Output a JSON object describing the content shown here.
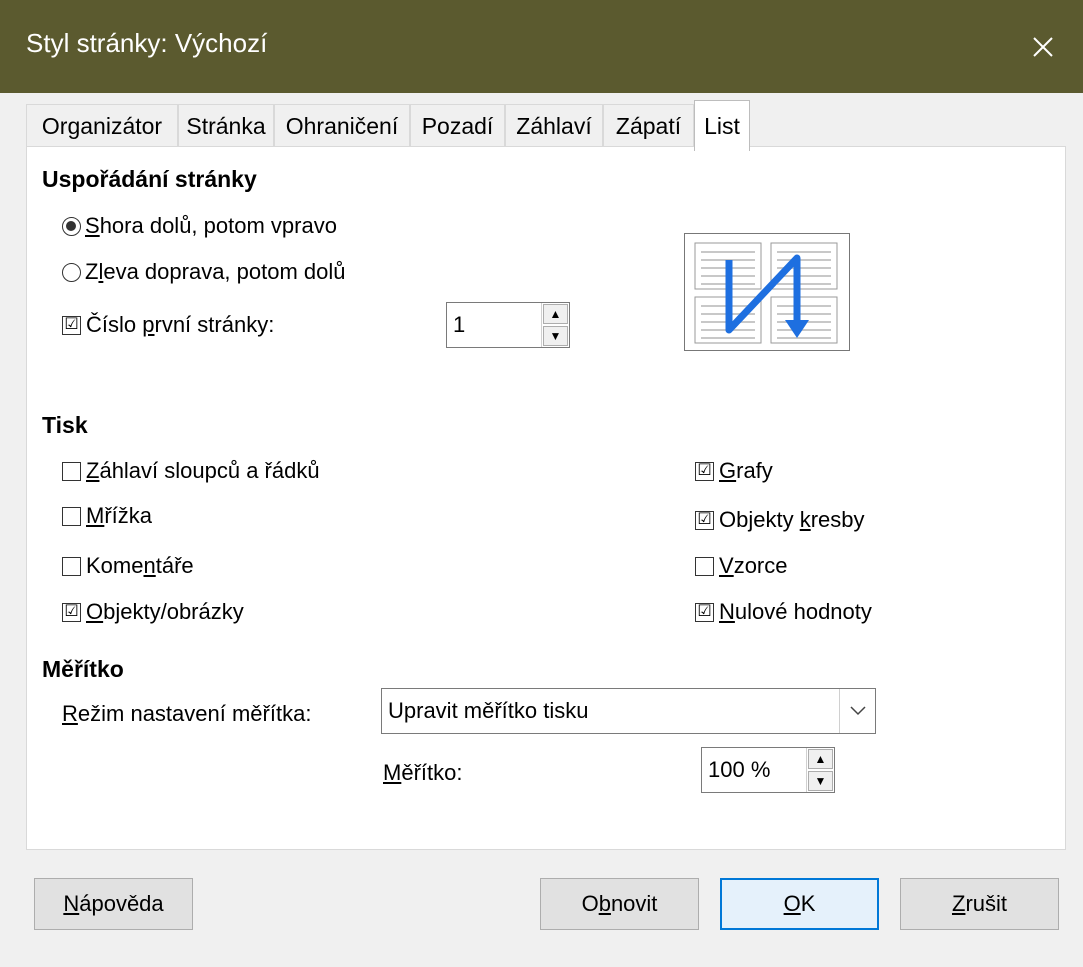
{
  "window": {
    "title": "Styl stránky: Výchozí",
    "close_icon": "close-icon"
  },
  "tabs": [
    {
      "label": "Organizátor"
    },
    {
      "label": "Stránka"
    },
    {
      "label": "Ohraničení"
    },
    {
      "label": "Pozadí"
    },
    {
      "label": "Záhlaví"
    },
    {
      "label": "Zápatí"
    },
    {
      "label": "List",
      "active": true
    }
  ],
  "page_order": {
    "heading": "Uspořádání stránky",
    "top_bottom": {
      "pre": "",
      "u": "S",
      "post": "hora dolů, potom vpravo",
      "selected": true
    },
    "left_right": {
      "pre": "Z",
      "u": "l",
      "post": "eva doprava, potom dolů",
      "selected": false
    },
    "first_page": {
      "pre": "Číslo ",
      "u": "p",
      "post": "rvní stránky:",
      "checked": true,
      "value": "1"
    }
  },
  "print": {
    "heading": "Tisk",
    "headers": {
      "pre": "",
      "u": "Z",
      "post": "áhlaví sloupců a řádků",
      "checked": false
    },
    "grid": {
      "pre": "",
      "u": "M",
      "post": "řížka",
      "checked": false
    },
    "comments": {
      "pre": "Kome",
      "u": "n",
      "post": "táře",
      "checked": false
    },
    "objects": {
      "pre": "",
      "u": "O",
      "post": "bjekty/obrázky",
      "checked": true
    },
    "charts": {
      "pre": "",
      "u": "G",
      "post": "rafy",
      "checked": true
    },
    "drawing": {
      "pre": "Objekty ",
      "u": "k",
      "post": "resby",
      "checked": true
    },
    "formulas": {
      "pre": "",
      "u": "V",
      "post": "zorce",
      "checked": false
    },
    "zero": {
      "pre": "",
      "u": "N",
      "post": "ulové hodnoty",
      "checked": true
    }
  },
  "scale": {
    "heading": "Měřítko",
    "mode_label": {
      "pre": "",
      "u": "R",
      "post": "ežim nastavení měřítka:"
    },
    "mode_value": "Upravit měřítko tisku",
    "scale_label": {
      "pre": "",
      "u": "M",
      "post": "ěřítko:"
    },
    "scale_value": "100 %"
  },
  "buttons": {
    "help": {
      "pre": "",
      "u": "N",
      "post": "ápověda"
    },
    "reset": {
      "pre": "O",
      "u": "b",
      "post": "novit"
    },
    "ok": {
      "pre": "",
      "u": "O",
      "post": "K"
    },
    "cancel": {
      "pre": "",
      "u": "Z",
      "post": "rušit"
    }
  },
  "check_glyph": "☑",
  "colors": {
    "titlebar": "#5b5a2f",
    "accent": "#0078d7",
    "arrow": "#1e6fe0"
  }
}
